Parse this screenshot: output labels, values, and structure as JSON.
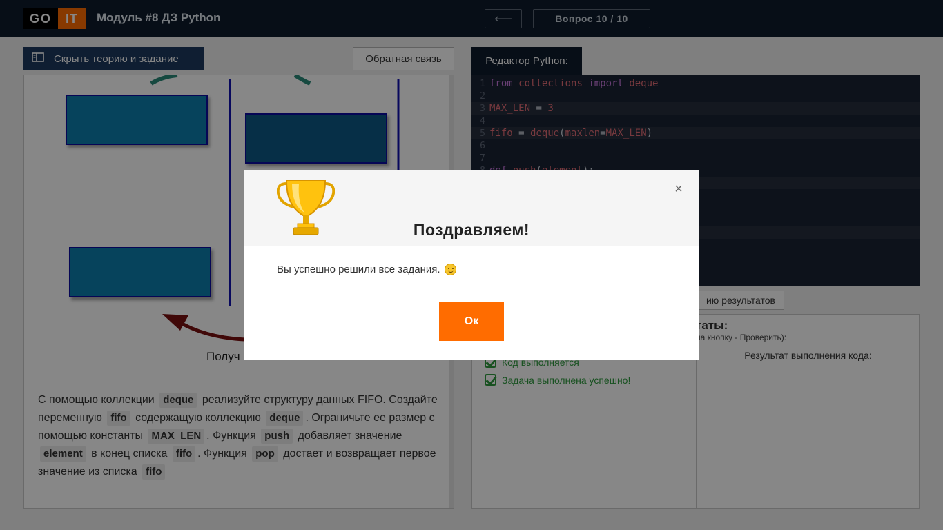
{
  "header": {
    "logo_go": "GO",
    "logo_it": "IT",
    "module_title": "Модуль #8 ДЗ Python",
    "back_arrow": "⟵",
    "question_counter": "Вопрос 10 / 10"
  },
  "left_panel": {
    "hide_button": "Скрыть теорию и задание",
    "feedback_button": "Обратная связь",
    "diagram_caption": "Получ",
    "task": {
      "p1": "С помощью коллекции",
      "c1": "deque",
      "p2": "реализуйте структуру данных FIFO. Создайте переменную",
      "c2": "fifo",
      "p3": "содержащую коллекцию",
      "c3": "deque",
      "p4": ". Ограничьте ее размер с помощью константы",
      "c4": "MAX_LEN",
      "p5": ". Функция",
      "c5": "push",
      "p6": "добавляет значение",
      "c6": "element",
      "p7": "в конец списка",
      "c7": "fifo",
      "p8": ". Функция",
      "c8": "pop",
      "p9": "достает и возвращает первое значение из списка",
      "c9": "fifo"
    }
  },
  "editor": {
    "tab_label": "Редактор Python:",
    "lines": [
      {
        "n": "1",
        "tokens": [
          [
            "kw",
            "from"
          ],
          [
            "punc",
            " "
          ],
          [
            "var",
            "collections"
          ],
          [
            "punc",
            " "
          ],
          [
            "kw",
            "import"
          ],
          [
            "punc",
            " "
          ],
          [
            "var",
            "deque"
          ]
        ]
      },
      {
        "n": "2",
        "tokens": []
      },
      {
        "n": "3",
        "tokens": [
          [
            "var",
            "MAX_LEN"
          ],
          [
            "punc",
            " = "
          ],
          [
            "var",
            "3"
          ]
        ]
      },
      {
        "n": "4",
        "tokens": []
      },
      {
        "n": "5",
        "tokens": [
          [
            "var",
            "fifo"
          ],
          [
            "punc",
            " = "
          ],
          [
            "var",
            "deque"
          ],
          [
            "punc",
            "("
          ],
          [
            "var",
            "maxlen"
          ],
          [
            "punc",
            "="
          ],
          [
            "var",
            "MAX_LEN"
          ],
          [
            "punc",
            ")"
          ]
        ]
      },
      {
        "n": "6",
        "tokens": []
      },
      {
        "n": "7",
        "tokens": []
      },
      {
        "n": "8",
        "tokens": [
          [
            "kw",
            "def"
          ],
          [
            "punc",
            " "
          ],
          [
            "var",
            "push"
          ],
          [
            "punc",
            "("
          ],
          [
            "var",
            "element"
          ],
          [
            "punc",
            "):"
          ]
        ]
      }
    ]
  },
  "results": {
    "button": "ию результатов",
    "title": "таты:",
    "hint": "на кнопку - Проверить):",
    "code_running": "Код выполняется",
    "task_done": "Задача выполнена успешно!",
    "output_header": "Результат выполнения кода:"
  },
  "modal": {
    "close": "×",
    "title": "Поздравляем!",
    "message": "Вы успешно решили все задания.",
    "ok_button": "Ок",
    "trophy_icon": "trophy-icon",
    "smiley_icon": "smiley-icon"
  }
}
